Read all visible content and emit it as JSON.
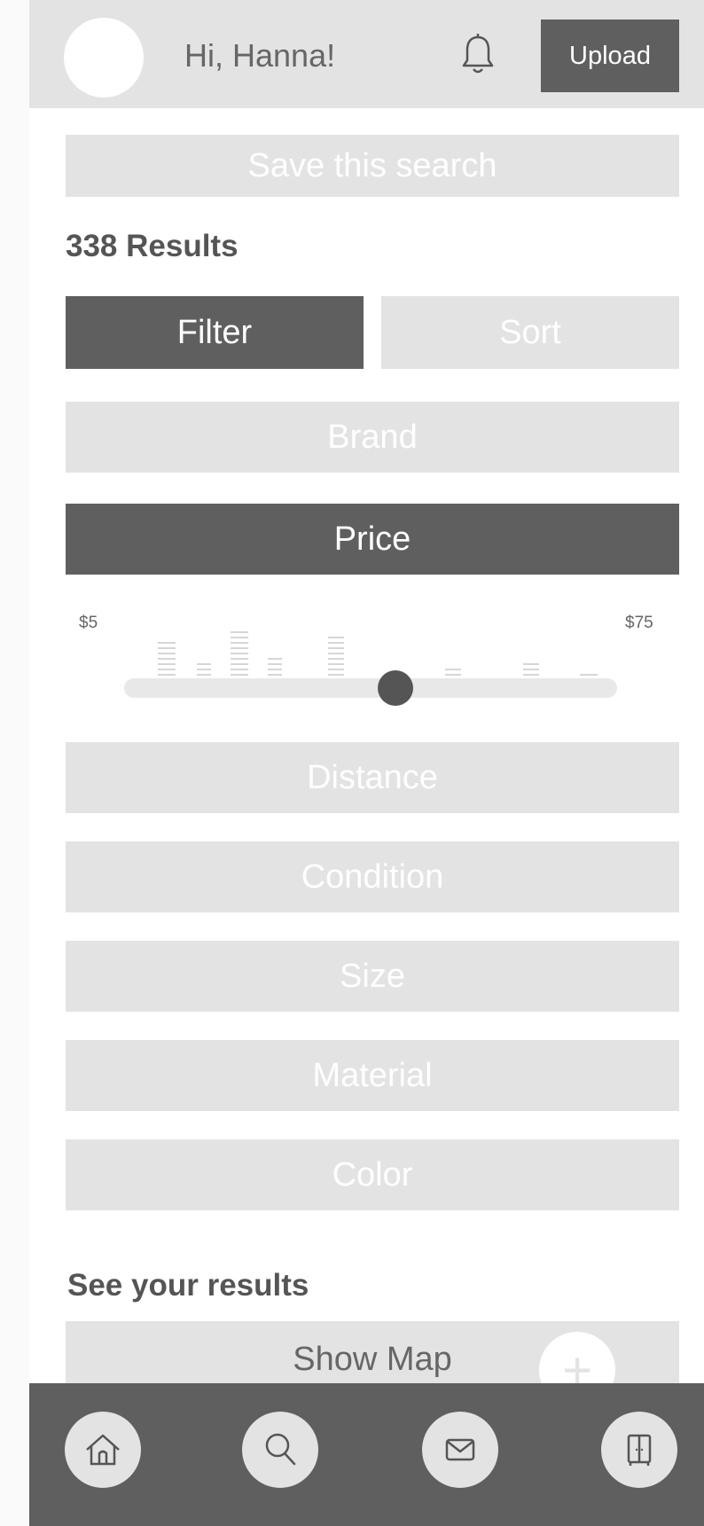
{
  "header": {
    "greeting": "Hi, Hanna!",
    "upload_label": "Upload",
    "notification_icon": "bell-icon"
  },
  "search": {
    "save_label": "Save this search",
    "results_count": "338 Results"
  },
  "tabs": {
    "filter_label": "Filter",
    "sort_label": "Sort",
    "active": "Filter"
  },
  "filters": {
    "brand": "Brand",
    "price": "Price",
    "distance": "Distance",
    "condition": "Condition",
    "size": "Size",
    "material": "Material",
    "color": "Color"
  },
  "price_slider": {
    "min_label": "$5",
    "max_label": "$75",
    "min": 5,
    "max": 75,
    "value_fraction": 0.55
  },
  "results": {
    "heading": "See your results",
    "show_map_label": "Show Map",
    "add_icon": "plus-icon"
  },
  "nav": {
    "items": [
      "home-icon",
      "search-icon",
      "mail-icon",
      "closet-icon"
    ]
  },
  "colors": {
    "dark": "#5f5f5f",
    "light": "#e3e3e3",
    "text": "#555555",
    "white": "#ffffff"
  }
}
